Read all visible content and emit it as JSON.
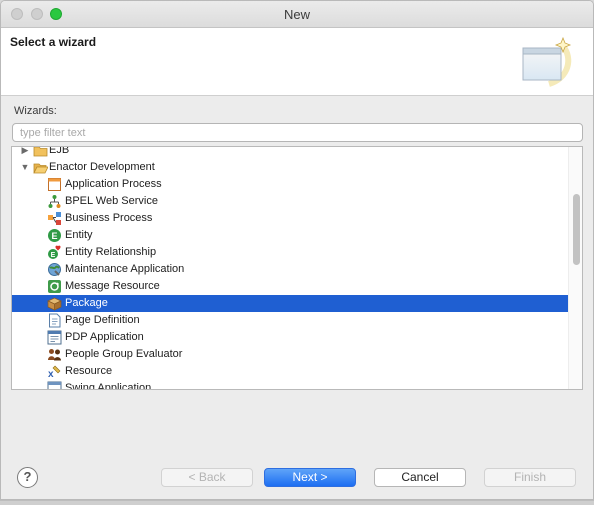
{
  "window": {
    "title": "New"
  },
  "header": {
    "title": "Select a wizard"
  },
  "wizards_label": "Wizards:",
  "filter": {
    "placeholder": "type filter text",
    "value": ""
  },
  "tree": {
    "top_items": [
      {
        "label": "EJB",
        "expanded": false
      },
      {
        "label": "Enactor Development",
        "expanded": true
      }
    ],
    "children": [
      {
        "label": "Application Process",
        "icon": "application-process-icon"
      },
      {
        "label": "BPEL Web Service",
        "icon": "bpel-web-service-icon"
      },
      {
        "label": "Business Process",
        "icon": "business-process-icon"
      },
      {
        "label": "Entity",
        "icon": "entity-icon"
      },
      {
        "label": "Entity Relationship",
        "icon": "entity-relationship-icon"
      },
      {
        "label": "Maintenance Application",
        "icon": "maintenance-application-icon"
      },
      {
        "label": "Message Resource",
        "icon": "message-resource-icon"
      },
      {
        "label": "Package",
        "icon": "package-icon",
        "selected": true
      },
      {
        "label": "Page Definition",
        "icon": "page-definition-icon"
      },
      {
        "label": "PDP Application",
        "icon": "pdp-application-icon"
      },
      {
        "label": "People Group Evaluator",
        "icon": "people-group-icon"
      },
      {
        "label": "Resource",
        "icon": "resource-icon"
      },
      {
        "label": "Swing Application",
        "icon": "swing-application-icon"
      }
    ]
  },
  "buttons": {
    "back": "< Back",
    "next": "Next >",
    "cancel": "Cancel",
    "finish": "Finish"
  },
  "colors": {
    "selection": "#1f5fd2",
    "default_button": "#1d6ef2",
    "maximize": "#2ac840"
  }
}
